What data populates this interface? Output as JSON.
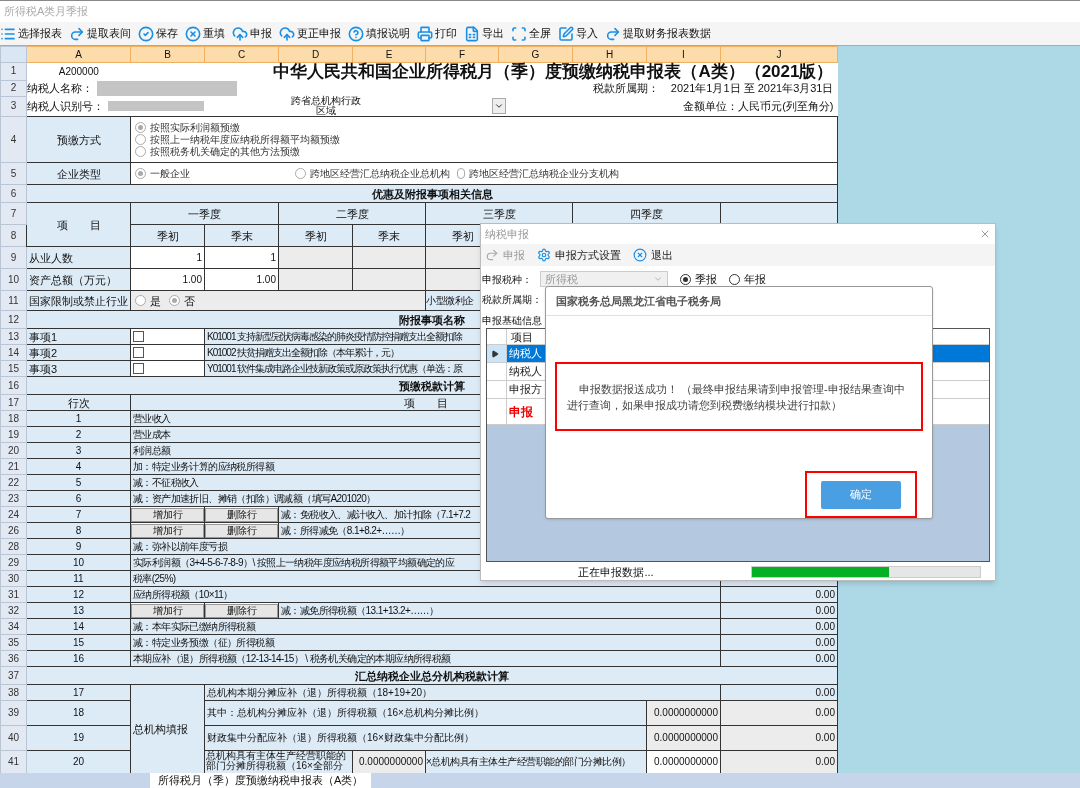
{
  "window": {
    "title": "所得税A类月季报"
  },
  "toolbar": [
    {
      "label": "选择报表"
    },
    {
      "label": "提取表间"
    },
    {
      "label": "保存"
    },
    {
      "label": "重填"
    },
    {
      "label": "申报"
    },
    {
      "label": "更正申报"
    },
    {
      "label": "填报说明"
    },
    {
      "label": "打印"
    },
    {
      "label": "导出"
    },
    {
      "label": "全屏"
    },
    {
      "label": "导入"
    },
    {
      "label": "提取财务报表数据"
    }
  ],
  "sheet": {
    "columns": [
      "A",
      "B",
      "C",
      "D",
      "E",
      "F",
      "G",
      "H",
      "I",
      "J"
    ],
    "rows": [
      {
        "num": "1",
        "kind": "title",
        "code": "A200000",
        "title": "中华人民共和国企业所得税月（季）度预缴纳税申报表（A类）（2021版）"
      },
      {
        "num": "2",
        "kind": "taxpayer-name",
        "label": "纳税人名称：",
        "period_label": "税款所属期：",
        "period": "2021年1月1日 至 2021年3月31日"
      },
      {
        "num": "3",
        "kind": "taxpayer-id",
        "label": "纳税人识别号：",
        "region_label": "跨省总机构行政区域",
        "unit": "金额单位：人民币元(列至角分)"
      },
      {
        "num": "4",
        "kind": "choice-stack",
        "label": "预缴方式",
        "options": [
          {
            "label": "按照实际利润额预缴",
            "selected": true
          },
          {
            "label": "按照上一纳税年度应纳税所得额平均额预缴",
            "selected": false
          },
          {
            "label": "按照税务机关确定的其他方法预缴",
            "selected": false
          }
        ]
      },
      {
        "num": "5",
        "kind": "choice-inline",
        "label": "企业类型",
        "options": [
          {
            "label": "一般企业",
            "selected": true
          },
          {
            "label": "跨地区经营汇总纳税企业总机构",
            "selected": false
          },
          {
            "label": "跨地区经营汇总纳税企业分支机构",
            "selected": false
          }
        ]
      },
      {
        "num": "6",
        "kind": "section",
        "title": "优惠及附报事项相关信息"
      },
      {
        "nums": [
          "7",
          "8"
        ],
        "kind": "quarter-header",
        "label": "项　　目",
        "quarters": [
          "一季度",
          "二季度",
          "三季度",
          "四季度"
        ],
        "subheaders": [
          "季初",
          "季末",
          "季初",
          "季末",
          "季初"
        ]
      },
      {
        "num": "9",
        "kind": "quarter-values",
        "label": "从业人数",
        "values": [
          "1",
          "1"
        ]
      },
      {
        "num": "10",
        "kind": "quarter-values",
        "label": "资产总额（万元）",
        "values": [
          "1.00",
          "1.00"
        ]
      },
      {
        "num": "11",
        "kind": "yes-no",
        "label": "国家限制或禁止行业",
        "options": [
          {
            "label": "是",
            "selected": false
          },
          {
            "label": "否",
            "selected": true
          }
        ],
        "side_label": "小型微利企"
      },
      {
        "num": "12",
        "kind": "section",
        "title": "附报事项名称"
      },
      {
        "num": "13",
        "kind": "item",
        "label": "事项1",
        "checked": false,
        "text": "K01001  支持新型冠状病毒感染的肺炎疫情防控捐赠支出全额扣除"
      },
      {
        "num": "14",
        "kind": "item",
        "label": "事项2",
        "checked": false,
        "text": "K01002  扶贫捐赠支出全额扣除（本年累计，元）"
      },
      {
        "num": "15",
        "kind": "item",
        "label": "事项3",
        "checked": false,
        "text": "Y01001  软件集成电路企业技新政策或原政策执行优惠（单选：原"
      },
      {
        "num": "16",
        "kind": "section",
        "title": "预缴税款计算"
      },
      {
        "num": "17",
        "kind": "column-header",
        "line": "行次",
        "item": "项　　目"
      },
      {
        "num": "18",
        "kind": "line",
        "line": "1",
        "text": "营业收入"
      },
      {
        "num": "19",
        "kind": "line",
        "line": "2",
        "text": "营业成本"
      },
      {
        "num": "20",
        "kind": "line",
        "line": "3",
        "text": "利润总额"
      },
      {
        "num": "21",
        "kind": "line",
        "line": "4",
        "text": "加：特定业务计算的应纳税所得额"
      },
      {
        "num": "22",
        "kind": "line",
        "line": "5",
        "text": "减：不征税收入"
      },
      {
        "num": "23",
        "kind": "line",
        "line": "6",
        "text": "减：资产加速折旧、摊销（扣除）调减额（填写A201020）"
      },
      {
        "num": "24",
        "kind": "line-buttons",
        "line": "7",
        "buttons": [
          "增加行",
          "删除行"
        ],
        "text": "减：免税收入、减计收入、加计扣除（7.1+7.2"
      },
      {
        "num": "26",
        "kind": "line-buttons",
        "line": "8",
        "buttons": [
          "增加行",
          "删除行"
        ],
        "text": "减：所得减免（8.1+8.2+……）"
      },
      {
        "num": "28",
        "kind": "line",
        "line": "9",
        "text": "减：弥补以前年度亏损"
      },
      {
        "num": "29",
        "kind": "line",
        "line": "10",
        "text": "实际利润额（3+4-5-6-7-8-9）\\ 按照上一纳税年度应纳税所得额平均额确定的应"
      },
      {
        "num": "30",
        "kind": "line",
        "line": "11",
        "text": "税率(25%)"
      },
      {
        "num": "31",
        "kind": "line",
        "line": "12",
        "text": "应纳所得税额（10×11）",
        "amount": "0.00"
      },
      {
        "num": "32",
        "kind": "line-buttons",
        "line": "13",
        "buttons": [
          "增加行",
          "删除行"
        ],
        "text": "减：减免所得税额（13.1+13.2+……）",
        "amount": "0.00"
      },
      {
        "num": "34",
        "kind": "line",
        "line": "14",
        "text": "减：本年实际已缴纳所得税额",
        "amount": "0.00"
      },
      {
        "num": "35",
        "kind": "line",
        "line": "15",
        "text": "减：特定业务预缴（征）所得税额",
        "amount": "0.00"
      },
      {
        "num": "36",
        "kind": "line",
        "line": "16",
        "text": "本期应补（退）所得税额（12-13-14-15） \\ 税务机关确定的本期应纳所得税额",
        "amount": "0.00"
      },
      {
        "num": "37",
        "kind": "section",
        "title": "汇总纳税企业总分机构税款计算"
      },
      {
        "num": "38",
        "kind": "branch-sum",
        "line": "17",
        "group": "总机构填报",
        "text": "总机构本期分摊应补（退）所得税额（18+19+20）",
        "amount": "0.00"
      },
      {
        "num": "39",
        "kind": "branch-ratio",
        "line": "18",
        "text": "其中：总机构分摊应补（退）所得税额（16×总机构分摊比例）",
        "ratio": "0.0000000000",
        "amount": "0.00"
      },
      {
        "num": "40",
        "kind": "branch-ratio",
        "line": "19",
        "text": "财政集中分配应补（退）所得税额（16×财政集中分配比例）",
        "ratio": "0.0000000000",
        "amount": "0.00"
      },
      {
        "num": "41",
        "kind": "branch-split",
        "line": "20",
        "text": "总机构具有主体生产经营职能的部门分摊所得税额（16×全部分",
        "share_ratio": "0.0000000000",
        "text2": "×总机构具有主体生产经营职能的部门分摊比例）",
        "ratio": "0.0000000000",
        "amount": "0.00"
      }
    ],
    "sheet_tab": "所得税月（季）度预缴纳税申报表（A类）"
  },
  "filing_dialog": {
    "title": "纳税申报",
    "toolbar": [
      {
        "label": "申报",
        "disabled": true
      },
      {
        "label": "申报方式设置",
        "disabled": false
      },
      {
        "label": "退出",
        "disabled": false
      }
    ],
    "tax_type_label": "申报税种：",
    "tax_type": "所得税",
    "period_types": [
      {
        "label": "季报",
        "selected": true
      },
      {
        "label": "年报",
        "selected": false
      }
    ],
    "period_label": "税款所属期：",
    "tab": "申报基础信息",
    "grid": {
      "column": "项目",
      "rows": [
        {
          "kind": "normal",
          "text": "纳税人",
          "selected": true
        },
        {
          "kind": "normal",
          "text": "纳税人",
          "selected": false
        },
        {
          "kind": "normal",
          "text": "申报方",
          "selected": false
        },
        {
          "kind": "alert",
          "text": "申报",
          "selected": false
        }
      ]
    },
    "status": "正在申报数据...",
    "level": 0.6
  },
  "message_box": {
    "title": "国家税务总局黑龙江省电子税务局",
    "message": "申报数据报送成功！ （最终申报结果请到申报管理-申报结果查询中进行查询，如果申报成功请您到税费缴纳模块进行扣款）",
    "button": "确定"
  }
}
